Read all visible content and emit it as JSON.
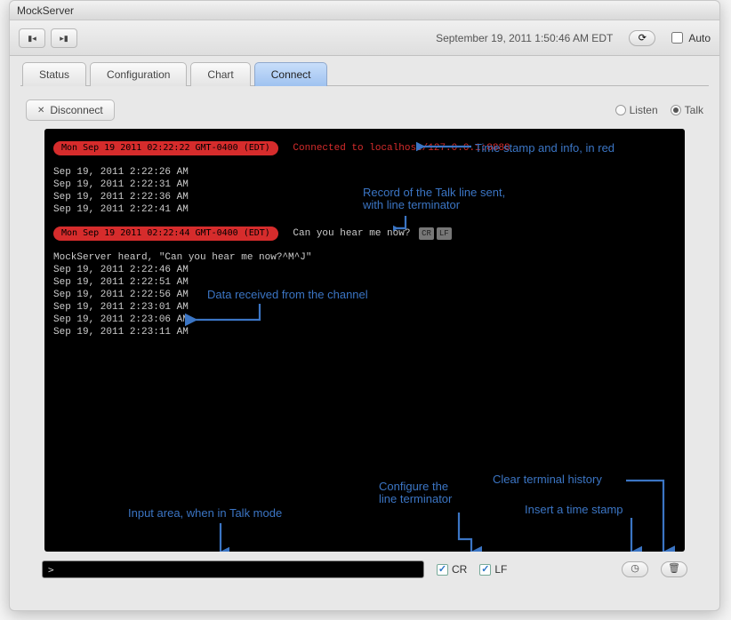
{
  "window": {
    "title": "MockServer"
  },
  "toolbar": {
    "clock": "September 19, 2011 1:50:46 AM EDT",
    "auto_label": "Auto"
  },
  "tabs": [
    {
      "label": "Status"
    },
    {
      "label": "Configuration"
    },
    {
      "label": "Chart"
    },
    {
      "label": "Connect",
      "active": true
    }
  ],
  "actions": {
    "disconnect_label": "Disconnect",
    "listen_label": "Listen",
    "talk_label": "Talk"
  },
  "terminal": {
    "pill1": "Mon Sep 19 2011 02:22:22 GMT-0400 (EDT)",
    "connected": "Connected to localhost/127.0.0.1:8888",
    "block1": [
      "Sep 19, 2011 2:22:26 AM",
      "Sep 19, 2011 2:22:31 AM",
      "Sep 19, 2011 2:22:36 AM",
      "Sep 19, 2011 2:22:41 AM"
    ],
    "pill2": "Mon Sep 19 2011 02:22:44 GMT-0400 (EDT)",
    "talk_line": "Can you hear me now?",
    "badge_cr": "CR",
    "badge_lf": "LF",
    "heard": "MockServer heard, \"Can you hear me now?^M^J\"",
    "block2": [
      "Sep 19, 2011 2:22:46 AM",
      "Sep 19, 2011 2:22:51 AM",
      "Sep 19, 2011 2:22:56 AM",
      "Sep 19, 2011 2:23:01 AM",
      "Sep 19, 2011 2:23:06 AM",
      "Sep 19, 2011 2:23:11 AM"
    ]
  },
  "annotations": {
    "timestamp_info": "Time stamp and info, in red",
    "talk_record": "Record of the Talk line sent,\nwith line terminator",
    "data_received": "Data received from the channel",
    "input_area": "Input area, when in Talk mode",
    "configure_lt": "Configure the\nline terminator",
    "clear_history": "Clear terminal history",
    "insert_ts": "Insert a time stamp"
  },
  "bottom": {
    "prompt": ">",
    "cr_label": "CR",
    "lf_label": "LF"
  },
  "icons": {
    "clock": "◷",
    "trash": "🗑",
    "refresh": "⟳",
    "back": "▮◂",
    "fwd": "▸▮"
  }
}
